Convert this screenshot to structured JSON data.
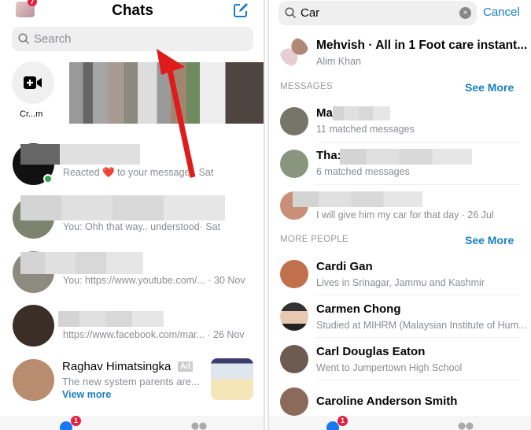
{
  "left": {
    "title": "Chats",
    "profile_badge": "7",
    "search_placeholder": "Search",
    "create_room_label": "Cr...m",
    "chats": [
      {
        "message": "Reacted ❤️ to your message · Sat",
        "online": true
      },
      {
        "message": "You: Ohh that way.. understood· Sat"
      },
      {
        "message": "You: https://www.youtube.com/... · 30 Nov"
      },
      {
        "message": "https://www.facebook.com/mar... · 26 Nov"
      }
    ],
    "ad": {
      "name": "Raghav Himatsingka",
      "badge": "Ad",
      "message": "The new system parents are...",
      "cta": "View more"
    },
    "tab_badge": "1"
  },
  "right": {
    "search_value": "Car",
    "cancel_label": "Cancel",
    "top_result": {
      "name": "Mehvish · All in 1 Foot care instant...",
      "sub": "Alim Khan"
    },
    "messages_header": "MESSAGES",
    "see_more": "See More",
    "messages": [
      {
        "name": "Ma",
        "sub": "11 matched messages"
      },
      {
        "name": "Tha:",
        "sub": "6 matched messages"
      },
      {
        "name": "",
        "sub": "I will give him my car for that day · 26 Jul"
      }
    ],
    "people_header": "MORE PEOPLE",
    "people": [
      {
        "name": "Cardi Gan",
        "sub": "Lives in Srinagar, Jammu and Kashmir"
      },
      {
        "name": "Carmen Chong",
        "sub": "Studied at MIHRM (Malaysian Institute of Hum..."
      },
      {
        "name": "Carl Douglas Eaton",
        "sub": "Went to Jumpertown High School"
      },
      {
        "name": "Caroline Anderson Smith",
        "sub": ""
      }
    ],
    "tab_badge": "1"
  },
  "colors": {
    "accent": "#1a7fc0",
    "badge": "#e41e3f",
    "arrow": "#e01b1b",
    "online": "#31a24c"
  }
}
